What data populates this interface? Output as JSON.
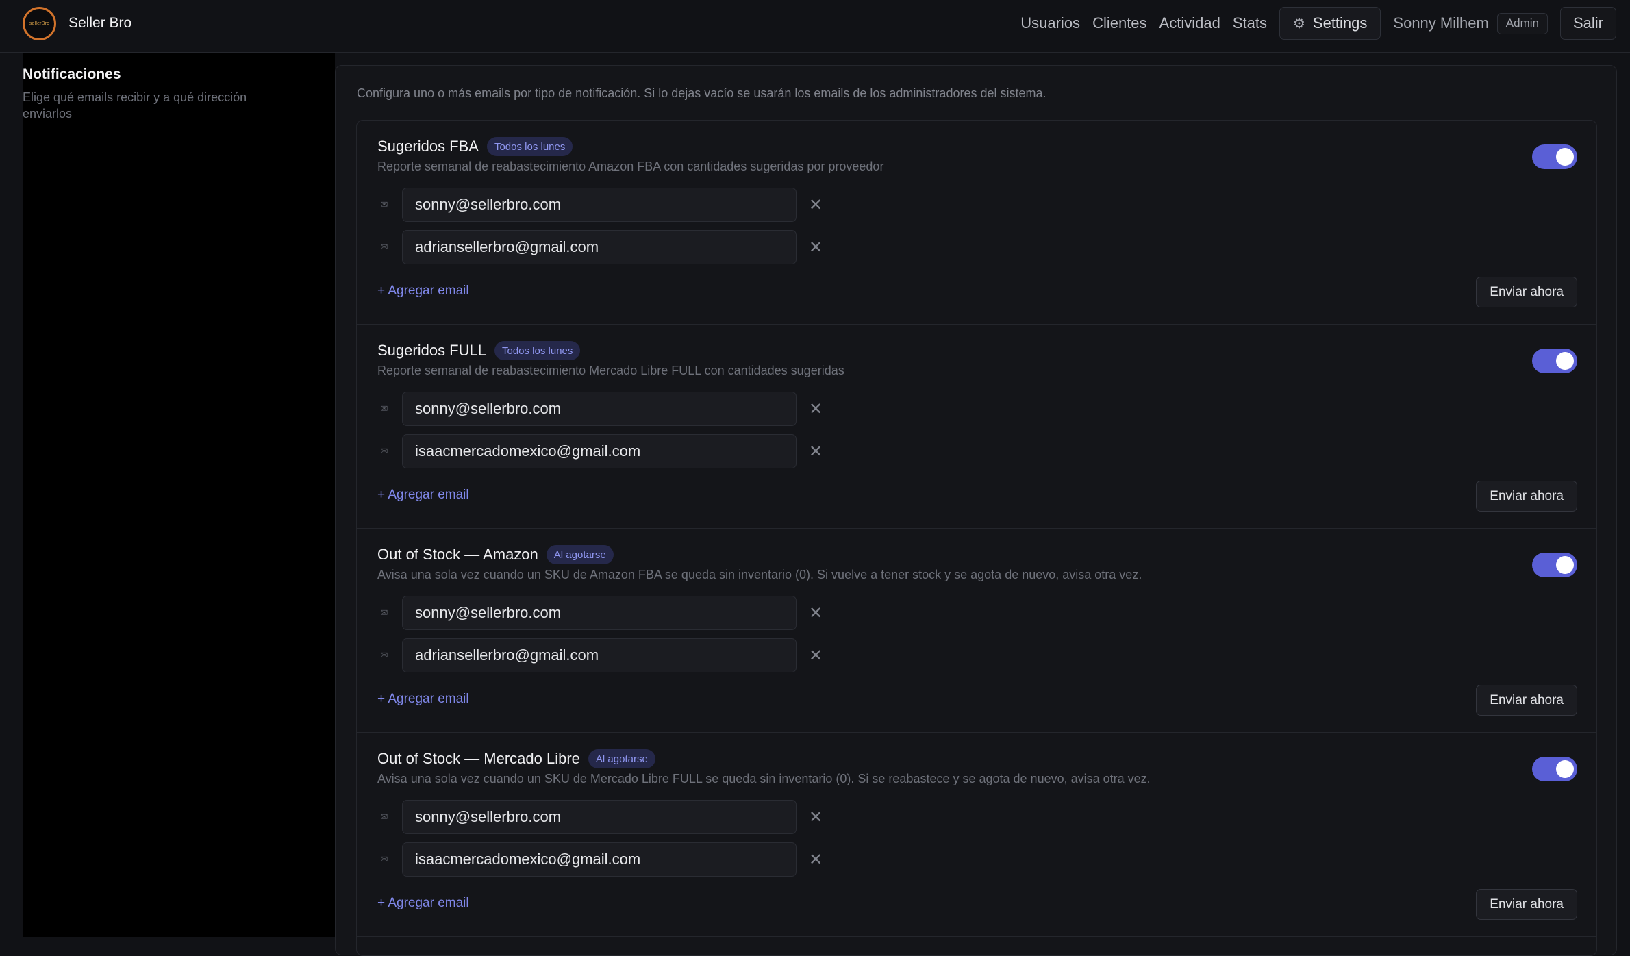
{
  "brand": {
    "logo_text": "sellerBro",
    "name": "Seller Bro"
  },
  "nav": {
    "links": [
      "Usuarios",
      "Clientes",
      "Actividad",
      "Stats"
    ],
    "settings_label": "Settings",
    "user_name": "Sonny Milhem",
    "role": "Admin",
    "logout_label": "Salir"
  },
  "sidebar": {
    "title": "Notificaciones",
    "description": "Elige qué emails recibir y a qué dirección enviarlos"
  },
  "main": {
    "intro": "Configura uno o más emails por tipo de notificación. Si lo dejas vacío se usarán los emails de los administradores del sistema.",
    "add_email_label": "+ Agregar email",
    "send_now_label": "Enviar ahora",
    "cards": [
      {
        "title": "Sugeridos FBA",
        "badge": "Todos los lunes",
        "description": "Reporte semanal de reabastecimiento Amazon FBA con cantidades sugeridas por proveedor",
        "enabled": true,
        "emails": [
          "sonny@sellerbro.com",
          "adriansellerbro@gmail.com"
        ]
      },
      {
        "title": "Sugeridos FULL",
        "badge": "Todos los lunes",
        "description": "Reporte semanal de reabastecimiento Mercado Libre FULL con cantidades sugeridas",
        "enabled": true,
        "emails": [
          "sonny@sellerbro.com",
          "isaacmercadomexico@gmail.com"
        ]
      },
      {
        "title": "Out of Stock — Amazon",
        "badge": "Al agotarse",
        "description": "Avisa una sola vez cuando un SKU de Amazon FBA se queda sin inventario (0). Si vuelve a tener stock y se agota de nuevo, avisa otra vez.",
        "enabled": true,
        "emails": [
          "sonny@sellerbro.com",
          "adriansellerbro@gmail.com"
        ]
      },
      {
        "title": "Out of Stock — Mercado Libre",
        "badge": "Al agotarse",
        "description": "Avisa una sola vez cuando un SKU de Mercado Libre FULL se queda sin inventario (0). Si se reabastece y se agota de nuevo, avisa otra vez.",
        "enabled": true,
        "emails": [
          "sonny@sellerbro.com",
          "isaacmercadomexico@gmail.com"
        ]
      }
    ]
  },
  "colors": {
    "accent": "#5a5fd6",
    "badge_text": "#8f96f0",
    "logo_ring": "#d2732b"
  }
}
